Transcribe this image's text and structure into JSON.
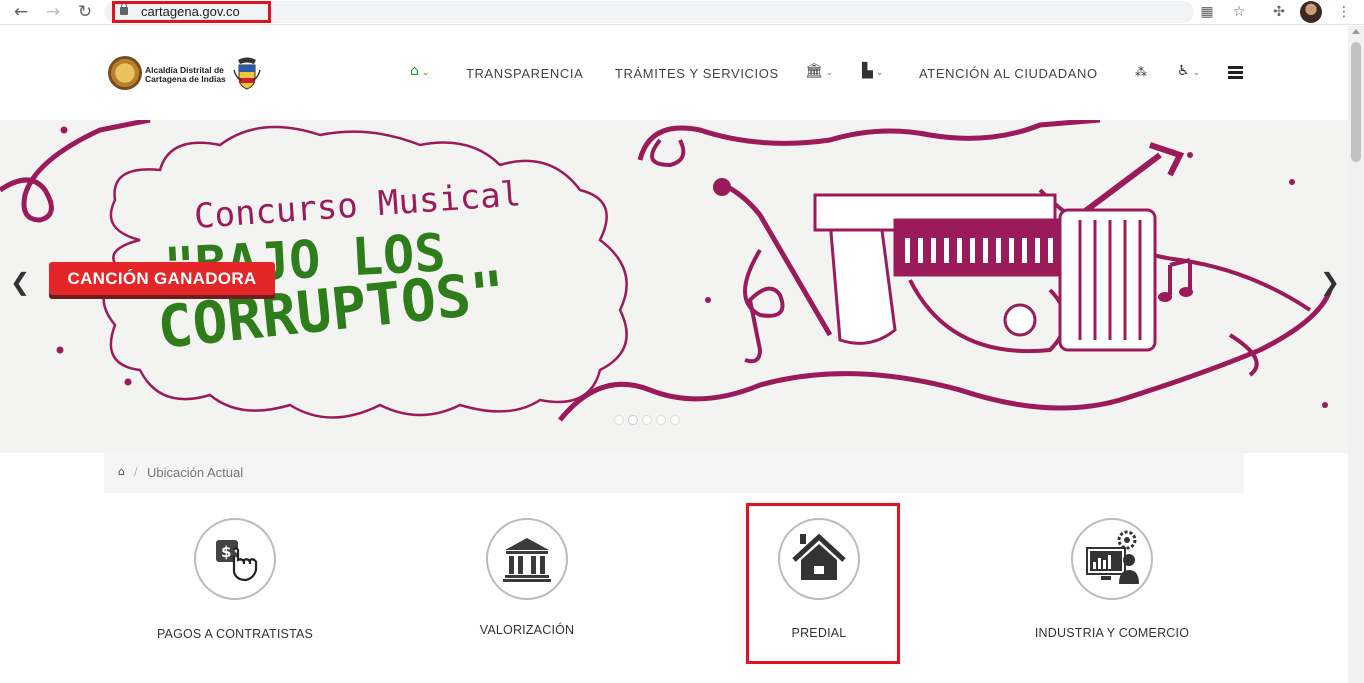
{
  "browser": {
    "url": "cartagena.gov.co",
    "back_icon": "arrow-left-icon",
    "forward_icon": "arrow-right-icon",
    "reload_icon": "reload-icon"
  },
  "header": {
    "logo_line1": "Alcaldía Distrital de",
    "logo_line2": "Cartagena de Indias",
    "nav": {
      "transparencia": "TRANSPARENCIA",
      "tramites": "TRÁMITES Y SERVICIOS",
      "atencion": "ATENCIÓN AL CIUDADANO"
    }
  },
  "hero": {
    "button_label": "CANCIÓN GANADORA",
    "headline_1": "Concurso Musical",
    "headline_2": "\"BAJO LOS",
    "headline_3": "CORRUPTOS\""
  },
  "breadcrumb": {
    "label": "Ubicación Actual"
  },
  "services": [
    {
      "label": "PAGOS A CONTRATISTAS",
      "icon": "payment-hand-icon"
    },
    {
      "label": "VALORIZACIÓN",
      "icon": "bank-building-icon"
    },
    {
      "label": "PREDIAL",
      "icon": "house-icon"
    },
    {
      "label": "INDUSTRIA Y COMERCIO",
      "icon": "industry-computer-icon"
    }
  ],
  "colors": {
    "highlight": "#e0141e",
    "banner_red": "#e52629",
    "magenta": "#9b1b5a",
    "green_text": "#2e7d1a",
    "home_green": "#1c9b3c"
  }
}
